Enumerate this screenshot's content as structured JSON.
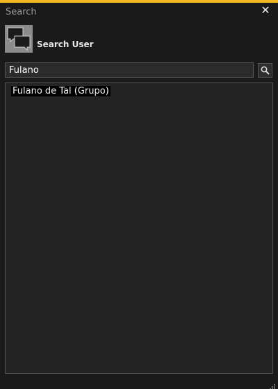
{
  "window": {
    "title": "Search",
    "close_symbol": "✕",
    "accent_color": "#f5b623"
  },
  "header": {
    "icon": "chat-bubbles-icon",
    "label": "Search User"
  },
  "search": {
    "value": "Fulano",
    "button_icon": "search-icon"
  },
  "results": {
    "items": [
      {
        "label": "Fulano de Tal (Grupo)"
      }
    ]
  },
  "footer": {
    "grip_icon": "resize-grip-icon"
  }
}
